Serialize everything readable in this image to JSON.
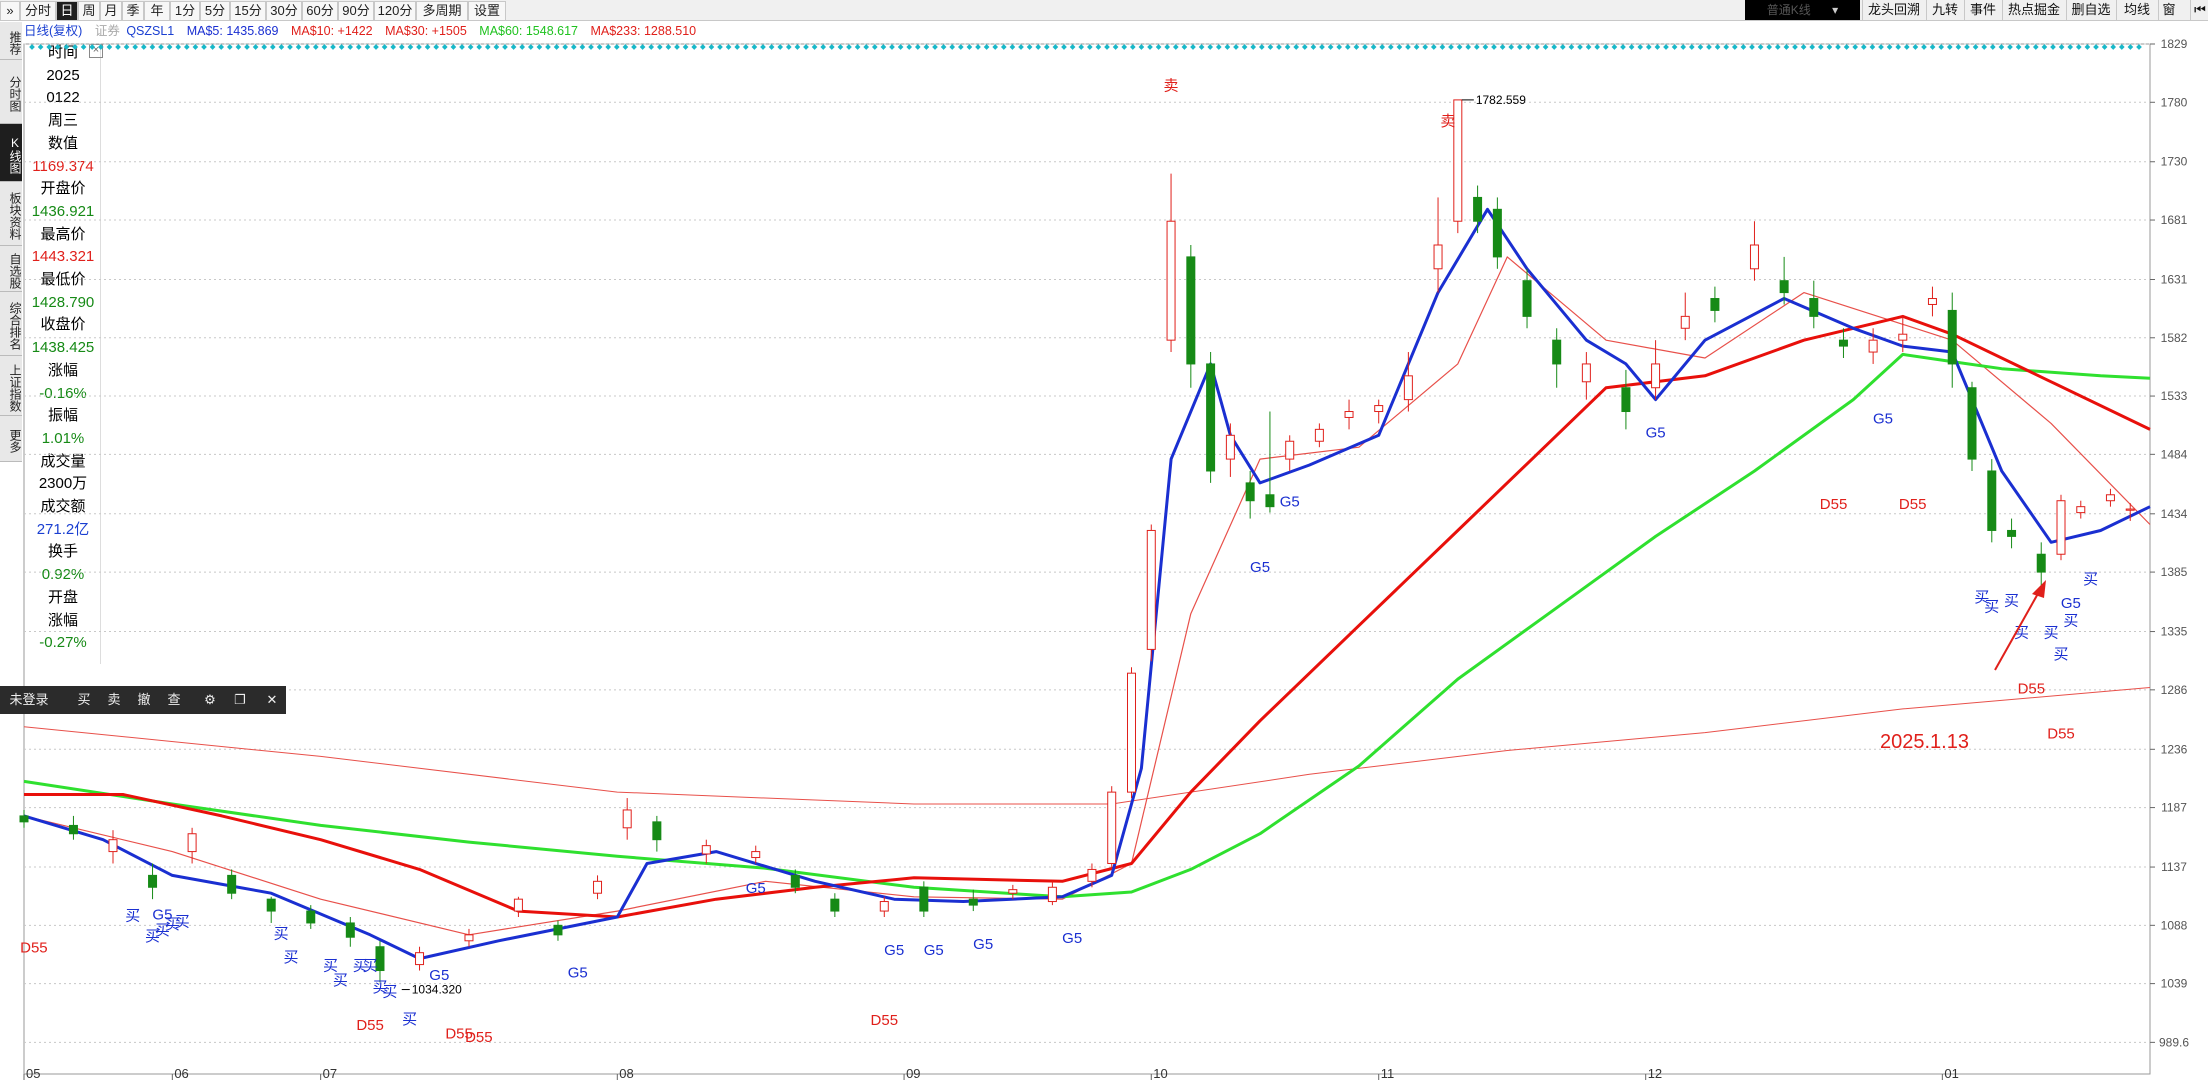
{
  "top_tabs": [
    {
      "label": "分时",
      "active": false
    },
    {
      "label": "日",
      "active": true
    },
    {
      "label": "周",
      "active": false
    },
    {
      "label": "月",
      "active": false
    },
    {
      "label": "季",
      "active": false
    },
    {
      "label": "年",
      "active": false
    },
    {
      "label": "1分",
      "active": false
    },
    {
      "label": "5分",
      "active": false
    },
    {
      "label": "15分",
      "active": false
    },
    {
      "label": "30分",
      "active": false
    },
    {
      "label": "60分",
      "active": false
    },
    {
      "label": "90分",
      "active": false
    },
    {
      "label": "120分",
      "active": false
    },
    {
      "label": "多周期",
      "active": false
    },
    {
      "label": "设置",
      "active": false
    }
  ],
  "kline_select": "普通K线",
  "right_toolbar": [
    "龙头回溯",
    "九转",
    "事件",
    "热点掘金",
    "删自选",
    "均线",
    "窗"
  ],
  "side_tabs": [
    {
      "label": "推荐",
      "active": false
    },
    {
      "label": "分时图",
      "active": false
    },
    {
      "label": "K线图",
      "active": true
    },
    {
      "label": "板块资料",
      "active": false
    },
    {
      "label": "自选股",
      "active": false
    },
    {
      "label": "综合排名",
      "active": false
    },
    {
      "label": "上证指数",
      "active": false
    },
    {
      "label": "更多",
      "active": false
    }
  ],
  "legend": {
    "name": "日线(复权)",
    "code": "QSZSL1",
    "code_prefix": "证券",
    "ma5": "MA$5: 1435.869",
    "ma10": "MA$10: +1422",
    "ma30": "MA$30: +1505",
    "ma60": "MA$60: 1548.617",
    "ma233": "MA$233: 1288.510"
  },
  "info_panel": [
    {
      "label": "时间"
    },
    {
      "value": "2025",
      "color": "#000"
    },
    {
      "value": "0122",
      "color": "#000"
    },
    {
      "value": "周三",
      "color": "#000"
    },
    {
      "label": "数值"
    },
    {
      "value": "1169.374",
      "color": "#e0201b"
    },
    {
      "label": "开盘价"
    },
    {
      "value": "1436.921",
      "color": "#168a16"
    },
    {
      "label": "最高价"
    },
    {
      "value": "1443.321",
      "color": "#e0201b"
    },
    {
      "label": "最低价"
    },
    {
      "value": "1428.790",
      "color": "#168a16"
    },
    {
      "label": "收盘价"
    },
    {
      "value": "1438.425",
      "color": "#168a16"
    },
    {
      "label": "涨幅"
    },
    {
      "value": "-0.16%",
      "color": "#168a16"
    },
    {
      "label": "振幅"
    },
    {
      "value": "1.01%",
      "color": "#168a16"
    },
    {
      "label": "成交量"
    },
    {
      "value": "2300万",
      "color": "#000"
    },
    {
      "label": "成交额"
    },
    {
      "value": "271.2亿",
      "color": "#1a3fd1"
    },
    {
      "label": "换手"
    },
    {
      "value": "0.92%",
      "color": "#168a16"
    },
    {
      "label": "开盘"
    },
    {
      "label": "涨幅"
    },
    {
      "value": "-0.27%",
      "color": "#168a16"
    }
  ],
  "trade_toolbar": [
    "未登录",
    "买",
    "卖",
    "撤",
    "查"
  ],
  "colors": {
    "up": "#e0201b",
    "down": "#168a16",
    "ma5": "#1a2fd1",
    "ma10": "#e8504a",
    "ma30": "#e8100b",
    "ma60": "#2fe02f",
    "ma233": "#e8504a",
    "grid": "#c8c8c8"
  },
  "chart_data": {
    "type": "candlestick",
    "y_ticks": [
      "1829",
      "1780",
      "1730",
      "1681",
      "1631",
      "1582",
      "1533",
      "1484",
      "1434",
      "1385",
      "1335",
      "1286",
      "1236",
      "1187",
      "1137",
      "1088",
      "1039",
      "989.6"
    ],
    "ylim": [
      963,
      1829
    ],
    "x_ticks": [
      "05",
      "06",
      "07",
      "08",
      "09",
      "10",
      "11",
      "12",
      "01"
    ],
    "x_tick_index": [
      0,
      15,
      30,
      60,
      89,
      114,
      137,
      164,
      194
    ],
    "annotations": {
      "high_label": "1782.559",
      "low_label": "1034.320",
      "date_note": "2025.1.13"
    },
    "ma60": [
      [
        0,
        1209
      ],
      [
        15,
        1190
      ],
      [
        30,
        1172
      ],
      [
        45,
        1158
      ],
      [
        60,
        1146
      ],
      [
        75,
        1136
      ],
      [
        90,
        1120
      ],
      [
        105,
        1112
      ],
      [
        112,
        1116
      ],
      [
        118,
        1135
      ],
      [
        125,
        1165
      ],
      [
        135,
        1222
      ],
      [
        145,
        1295
      ],
      [
        155,
        1355
      ],
      [
        165,
        1415
      ],
      [
        175,
        1470
      ],
      [
        185,
        1530
      ],
      [
        190,
        1568
      ],
      [
        195,
        1562
      ],
      [
        200,
        1556
      ],
      [
        210,
        1550
      ],
      [
        215,
        1548
      ]
    ],
    "ma30": [
      [
        0,
        1198
      ],
      [
        10,
        1198
      ],
      [
        20,
        1180
      ],
      [
        30,
        1160
      ],
      [
        40,
        1135
      ],
      [
        50,
        1100
      ],
      [
        60,
        1095
      ],
      [
        70,
        1110
      ],
      [
        80,
        1120
      ],
      [
        90,
        1128
      ],
      [
        105,
        1125
      ],
      [
        112,
        1140
      ],
      [
        118,
        1200
      ],
      [
        125,
        1260
      ],
      [
        135,
        1340
      ],
      [
        145,
        1420
      ],
      [
        155,
        1500
      ],
      [
        160,
        1540
      ],
      [
        170,
        1550
      ],
      [
        180,
        1580
      ],
      [
        190,
        1600
      ],
      [
        195,
        1585
      ],
      [
        205,
        1545
      ],
      [
        215,
        1505
      ]
    ],
    "ma233": [
      [
        0,
        1255
      ],
      [
        30,
        1230
      ],
      [
        60,
        1200
      ],
      [
        90,
        1190
      ],
      [
        110,
        1190
      ],
      [
        130,
        1215
      ],
      [
        150,
        1235
      ],
      [
        170,
        1250
      ],
      [
        190,
        1270
      ],
      [
        215,
        1288
      ]
    ],
    "ma5": [
      [
        0,
        1180
      ],
      [
        8,
        1160
      ],
      [
        15,
        1130
      ],
      [
        25,
        1115
      ],
      [
        35,
        1080
      ],
      [
        40,
        1060
      ],
      [
        48,
        1075
      ],
      [
        60,
        1095
      ],
      [
        63,
        1140
      ],
      [
        70,
        1150
      ],
      [
        80,
        1125
      ],
      [
        88,
        1110
      ],
      [
        95,
        1108
      ],
      [
        105,
        1112
      ],
      [
        110,
        1130
      ],
      [
        113,
        1220
      ],
      [
        116,
        1480
      ],
      [
        120,
        1560
      ],
      [
        122,
        1500
      ],
      [
        125,
        1460
      ],
      [
        130,
        1475
      ],
      [
        137,
        1500
      ],
      [
        143,
        1620
      ],
      [
        148,
        1690
      ],
      [
        152,
        1640
      ],
      [
        158,
        1580
      ],
      [
        162,
        1560
      ],
      [
        165,
        1530
      ],
      [
        170,
        1580
      ],
      [
        178,
        1615
      ],
      [
        185,
        1590
      ],
      [
        190,
        1575
      ],
      [
        195,
        1570
      ],
      [
        200,
        1470
      ],
      [
        205,
        1410
      ],
      [
        210,
        1420
      ],
      [
        215,
        1440
      ]
    ],
    "ma10": [
      [
        0,
        1180
      ],
      [
        15,
        1150
      ],
      [
        30,
        1110
      ],
      [
        45,
        1080
      ],
      [
        60,
        1100
      ],
      [
        75,
        1125
      ],
      [
        90,
        1112
      ],
      [
        105,
        1110
      ],
      [
        112,
        1140
      ],
      [
        118,
        1350
      ],
      [
        125,
        1480
      ],
      [
        135,
        1490
      ],
      [
        145,
        1560
      ],
      [
        150,
        1650
      ],
      [
        160,
        1580
      ],
      [
        170,
        1565
      ],
      [
        180,
        1620
      ],
      [
        195,
        1580
      ],
      [
        205,
        1510
      ],
      [
        215,
        1425
      ]
    ],
    "candles": [
      [
        0,
        1180,
        1175,
        1185,
        1170
      ],
      [
        5,
        1172,
        1165,
        1180,
        1160
      ],
      [
        9,
        1150,
        1160,
        1168,
        1140
      ],
      [
        13,
        1130,
        1120,
        1140,
        1110
      ],
      [
        17,
        1150,
        1165,
        1170,
        1140
      ],
      [
        21,
        1130,
        1115,
        1135,
        1110
      ],
      [
        25,
        1110,
        1100,
        1112,
        1090
      ],
      [
        29,
        1100,
        1090,
        1105,
        1085
      ],
      [
        33,
        1090,
        1078,
        1095,
        1070
      ],
      [
        36,
        1070,
        1050,
        1075,
        1040
      ],
      [
        40,
        1055,
        1065,
        1070,
        1050
      ],
      [
        45,
        1075,
        1080,
        1085,
        1070
      ],
      [
        50,
        1100,
        1110,
        1112,
        1095
      ],
      [
        54,
        1088,
        1080,
        1092,
        1075
      ],
      [
        58,
        1115,
        1125,
        1130,
        1110
      ],
      [
        61,
        1170,
        1185,
        1195,
        1160
      ],
      [
        64,
        1175,
        1160,
        1180,
        1150
      ],
      [
        69,
        1148,
        1155,
        1160,
        1140
      ],
      [
        74,
        1145,
        1150,
        1155,
        1140
      ],
      [
        78,
        1130,
        1120,
        1135,
        1115
      ],
      [
        82,
        1110,
        1100,
        1115,
        1095
      ],
      [
        87,
        1100,
        1108,
        1112,
        1095
      ],
      [
        91,
        1120,
        1100,
        1125,
        1095
      ],
      [
        96,
        1110,
        1105,
        1118,
        1100
      ],
      [
        100,
        1115,
        1118,
        1122,
        1110
      ],
      [
        104,
        1108,
        1120,
        1125,
        1105
      ],
      [
        108,
        1125,
        1135,
        1140,
        1120
      ],
      [
        110,
        1140,
        1200,
        1205,
        1135
      ],
      [
        112,
        1200,
        1300,
        1305,
        1195
      ],
      [
        114,
        1320,
        1420,
        1425,
        1310
      ],
      [
        116,
        1580,
        1680,
        1720,
        1570
      ],
      [
        118,
        1650,
        1560,
        1660,
        1540
      ],
      [
        120,
        1560,
        1470,
        1570,
        1460
      ],
      [
        122,
        1480,
        1500,
        1510,
        1465
      ],
      [
        124,
        1460,
        1445,
        1470,
        1430
      ],
      [
        126,
        1450,
        1440,
        1520,
        1435
      ],
      [
        128,
        1480,
        1495,
        1500,
        1470
      ],
      [
        131,
        1495,
        1505,
        1510,
        1490
      ],
      [
        134,
        1515,
        1520,
        1530,
        1505
      ],
      [
        137,
        1520,
        1525,
        1530,
        1510
      ],
      [
        140,
        1530,
        1550,
        1570,
        1520
      ],
      [
        143,
        1640,
        1660,
        1700,
        1620
      ],
      [
        145,
        1680,
        1782,
        1782,
        1670
      ],
      [
        147,
        1700,
        1680,
        1710,
        1670
      ],
      [
        149,
        1690,
        1650,
        1700,
        1640
      ],
      [
        152,
        1630,
        1600,
        1640,
        1590
      ],
      [
        155,
        1580,
        1560,
        1590,
        1540
      ],
      [
        158,
        1545,
        1560,
        1570,
        1530
      ],
      [
        162,
        1540,
        1520,
        1555,
        1505
      ],
      [
        165,
        1540,
        1560,
        1580,
        1530
      ],
      [
        168,
        1590,
        1600,
        1620,
        1580
      ],
      [
        171,
        1615,
        1605,
        1625,
        1595
      ],
      [
        175,
        1640,
        1660,
        1680,
        1630
      ],
      [
        178,
        1630,
        1620,
        1650,
        1610
      ],
      [
        181,
        1615,
        1600,
        1630,
        1590
      ],
      [
        184,
        1580,
        1575,
        1590,
        1565
      ],
      [
        187,
        1570,
        1580,
        1590,
        1560
      ],
      [
        190,
        1580,
        1585,
        1600,
        1570
      ],
      [
        193,
        1610,
        1615,
        1625,
        1600
      ],
      [
        195,
        1605,
        1560,
        1620,
        1540
      ],
      [
        197,
        1540,
        1480,
        1545,
        1470
      ],
      [
        199,
        1470,
        1420,
        1480,
        1410
      ],
      [
        201,
        1420,
        1415,
        1430,
        1405
      ],
      [
        204,
        1400,
        1385,
        1410,
        1370
      ],
      [
        206,
        1400,
        1445,
        1450,
        1395
      ],
      [
        208,
        1435,
        1440,
        1445,
        1430
      ],
      [
        211,
        1445,
        1450,
        1455,
        1440
      ],
      [
        213,
        1437,
        1438,
        1443,
        1428
      ]
    ],
    "labels": [
      {
        "text": "卖",
        "i": 116,
        "v": 1790,
        "color": "#e0201b"
      },
      {
        "text": "卖",
        "i": 144,
        "v": 1760,
        "color": "#e0201b"
      },
      {
        "text": "G5",
        "i": 128,
        "v": 1440,
        "color": "#1a2fd1"
      },
      {
        "text": "G5",
        "i": 125,
        "v": 1385,
        "color": "#1a2fd1"
      },
      {
        "text": "G5",
        "i": 165,
        "v": 1498,
        "color": "#1a2fd1"
      },
      {
        "text": "G5",
        "i": 188,
        "v": 1510,
        "color": "#1a2fd1"
      },
      {
        "text": "G5",
        "i": 14,
        "v": 1093,
        "color": "#1a2fd1"
      },
      {
        "text": "G5",
        "i": 74,
        "v": 1115,
        "color": "#1a2fd1"
      },
      {
        "text": "G5",
        "i": 42,
        "v": 1042,
        "color": "#1a2fd1"
      },
      {
        "text": "G5",
        "i": 56,
        "v": 1044,
        "color": "#1a2fd1"
      },
      {
        "text": "G5",
        "i": 88,
        "v": 1063,
        "color": "#1a2fd1"
      },
      {
        "text": "G5",
        "i": 92,
        "v": 1063,
        "color": "#1a2fd1"
      },
      {
        "text": "G5",
        "i": 97,
        "v": 1068,
        "color": "#1a2fd1"
      },
      {
        "text": "G5",
        "i": 106,
        "v": 1073,
        "color": "#1a2fd1"
      },
      {
        "text": "G5",
        "i": 207,
        "v": 1355,
        "color": "#1a2fd1"
      },
      {
        "text": "D55",
        "i": 1,
        "v": 1065,
        "color": "#e0201b"
      },
      {
        "text": "D55",
        "i": 35,
        "v": 1000,
        "color": "#e0201b"
      },
      {
        "text": "D55",
        "i": 44,
        "v": 993,
        "color": "#e0201b"
      },
      {
        "text": "D55",
        "i": 46,
        "v": 990,
        "color": "#e0201b"
      },
      {
        "text": "D55",
        "i": 87,
        "v": 1004,
        "color": "#e0201b"
      },
      {
        "text": "D55",
        "i": 183,
        "v": 1438,
        "color": "#e0201b"
      },
      {
        "text": "D55",
        "i": 191,
        "v": 1438,
        "color": "#e0201b"
      },
      {
        "text": "D55",
        "i": 203,
        "v": 1283,
        "color": "#e0201b"
      },
      {
        "text": "D55",
        "i": 206,
        "v": 1245,
        "color": "#e0201b"
      },
      {
        "text": "买",
        "i": 11,
        "v": 1092,
        "color": "#1a2fd1"
      },
      {
        "text": "买",
        "i": 13,
        "v": 1075,
        "color": "#1a2fd1"
      },
      {
        "text": "买",
        "i": 14,
        "v": 1080,
        "color": "#1a2fd1"
      },
      {
        "text": "买",
        "i": 15,
        "v": 1085,
        "color": "#1a2fd1"
      },
      {
        "text": "买",
        "i": 16,
        "v": 1087,
        "color": "#1a2fd1"
      },
      {
        "text": "买",
        "i": 26,
        "v": 1077,
        "color": "#1a2fd1"
      },
      {
        "text": "买",
        "i": 27,
        "v": 1057,
        "color": "#1a2fd1"
      },
      {
        "text": "买",
        "i": 31,
        "v": 1050,
        "color": "#1a2fd1"
      },
      {
        "text": "买",
        "i": 32,
        "v": 1038,
        "color": "#1a2fd1"
      },
      {
        "text": "买",
        "i": 34,
        "v": 1050,
        "color": "#1a2fd1"
      },
      {
        "text": "买",
        "i": 35,
        "v": 1050,
        "color": "#1a2fd1"
      },
      {
        "text": "买",
        "i": 36,
        "v": 1032,
        "color": "#1a2fd1"
      },
      {
        "text": "买",
        "i": 37,
        "v": 1028,
        "color": "#1a2fd1"
      },
      {
        "text": "买",
        "i": 39,
        "v": 1005,
        "color": "#1a2fd1"
      },
      {
        "text": "买",
        "i": 198,
        "v": 1360,
        "color": "#1a2fd1"
      },
      {
        "text": "买",
        "i": 199,
        "v": 1352,
        "color": "#1a2fd1"
      },
      {
        "text": "买",
        "i": 201,
        "v": 1357,
        "color": "#1a2fd1"
      },
      {
        "text": "买",
        "i": 202,
        "v": 1330,
        "color": "#1a2fd1"
      },
      {
        "text": "买",
        "i": 205,
        "v": 1330,
        "color": "#1a2fd1"
      },
      {
        "text": "买",
        "i": 206,
        "v": 1312,
        "color": "#1a2fd1"
      },
      {
        "text": "买",
        "i": 207,
        "v": 1340,
        "color": "#1a2fd1"
      },
      {
        "text": "买",
        "i": 209,
        "v": 1375,
        "color": "#1a2fd1"
      }
    ]
  }
}
